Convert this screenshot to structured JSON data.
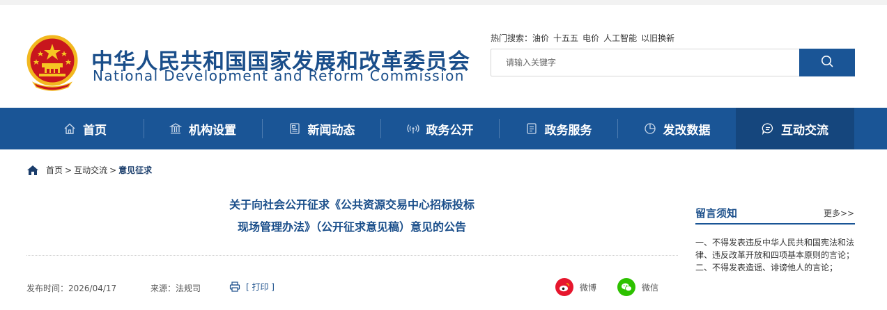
{
  "header": {
    "title_cn": "中华人民共和国国家发展和改革委员会",
    "title_en": "National Development and Reform Commission",
    "emblem_icon": "national-emblem-icon"
  },
  "search": {
    "hot_label": "热门搜索：",
    "hot_terms": [
      "油价",
      "十五五",
      "电价",
      "人工智能",
      "以旧换新"
    ],
    "placeholder": "请输入关键字",
    "icon": "search-icon"
  },
  "nav": {
    "items": [
      {
        "label": "首页",
        "icon": "home-icon"
      },
      {
        "label": "机构设置",
        "icon": "building-icon"
      },
      {
        "label": "新闻动态",
        "icon": "news-icon"
      },
      {
        "label": "政务公开",
        "icon": "broadcast-icon"
      },
      {
        "label": "政务服务",
        "icon": "document-icon"
      },
      {
        "label": "发改数据",
        "icon": "pie-chart-icon"
      },
      {
        "label": "互动交流",
        "icon": "chat-icon"
      }
    ],
    "active_index": 6
  },
  "breadcrumb": {
    "items": [
      "首页",
      "互动交流",
      "意见征求"
    ],
    "separator": ">"
  },
  "article": {
    "title_line1": "关于向社会公开征求《公共资源交易中心招标投标",
    "title_line2": "现场管理办法》（公开征求意见稿）意见的公告",
    "publish_label": "发布时间：",
    "publish_date": "2026/04/17",
    "source_label": "来源：",
    "source": "法规司",
    "print_label": "[ 打印 ]",
    "share": {
      "weibo": "微博",
      "wechat": "微信"
    }
  },
  "sidebar": {
    "title": "留言须知",
    "more": "更多>>",
    "lines": [
      "一、不得发表违反中华人民共和国宪法和法律、违反改革开放和四项基本原则的言论；",
      "二、不得发表造谣、诽谤他人的言论；"
    ]
  },
  "colors": {
    "brand_blue": "#1a5596",
    "nav_active": "#15467d",
    "title_blue": "#1a4e8a",
    "weibo_red": "#e6162d",
    "wechat_green": "#2dc100"
  }
}
